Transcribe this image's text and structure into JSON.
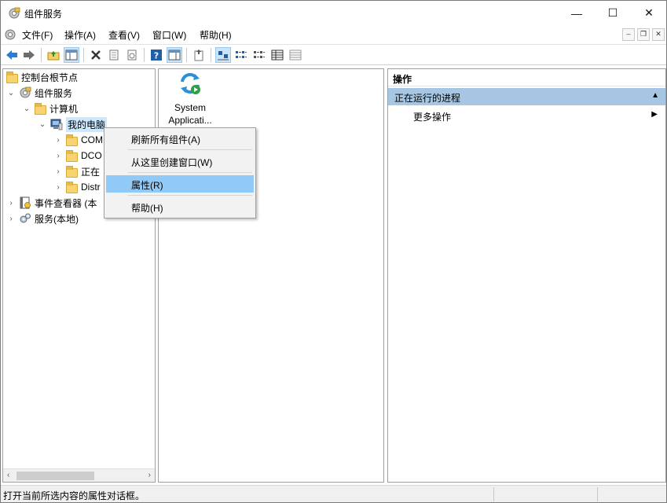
{
  "window": {
    "title": "组件服务",
    "controls": {
      "minimize": "—",
      "maximize": "☐",
      "close": "✕"
    }
  },
  "menubar": {
    "items": [
      "文件(F)",
      "操作(A)",
      "查看(V)",
      "窗口(W)",
      "帮助(H)"
    ],
    "mdi": {
      "minimize": "–",
      "restore": "❐",
      "close": "✕"
    }
  },
  "toolbar": {
    "buttons": [
      "back-icon",
      "forward-icon",
      "up-folder-icon",
      "show-hide-tree-icon",
      "delete-icon",
      "properties-icon",
      "refresh-icon",
      "help-icon",
      "show-action-pane-icon",
      "export-icon",
      "large-icons-view-icon",
      "small-icons-view-icon",
      "list-view-icon",
      "details-view-icon",
      "status-view-icon"
    ]
  },
  "tree": {
    "root": "控制台根节点",
    "component_services": "组件服务",
    "computers": "计算机",
    "my_computer": "我的电脑",
    "com": "COM",
    "dco": "DCO",
    "running": "正在",
    "distr": "Distr",
    "event_viewer": "事件查看器 (本",
    "services": "服务(本地)"
  },
  "middle": {
    "item_label_1": "System",
    "item_label_2": "Applicati..."
  },
  "actions": {
    "header": "操作",
    "section": "正在运行的进程",
    "more": "更多操作"
  },
  "context_menu": {
    "refresh_all": "刷新所有组件(A)",
    "new_window": "从这里创建窗口(W)",
    "properties": "属性(R)",
    "help": "帮助(H)"
  },
  "status": {
    "text": "打开当前所选内容的属性对话框。"
  },
  "colors": {
    "accent_selection": "#91c9f7",
    "section_header": "#a6c6e3",
    "tree_selected": "#cce8ff"
  }
}
